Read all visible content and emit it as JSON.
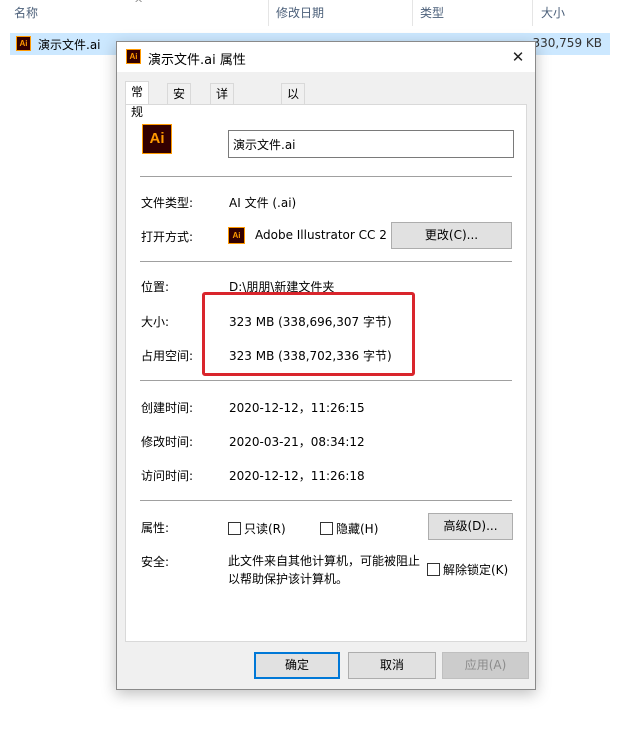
{
  "explorer": {
    "columns": [
      "名称",
      "修改日期",
      "类型",
      "大小"
    ],
    "file": {
      "icon": "ai-file-icon",
      "icon_text": "Ai",
      "name": "演示文件.ai",
      "size": "330,759 KB"
    }
  },
  "dialog": {
    "title": "演示文件.ai 属性",
    "title_icon_text": "Ai",
    "tabs": [
      "常规",
      "安全",
      "详细信息",
      "以前的版本"
    ],
    "big_icon_text": "Ai",
    "filename": "演示文件.ai",
    "file_type_label": "文件类型:",
    "file_type_value": "AI 文件 (.ai)",
    "open_with_label": "打开方式:",
    "open_with_icon_text": "Ai",
    "open_with_value": "Adobe Illustrator CC 2",
    "change_button": "更改(C)...",
    "location_label": "位置:",
    "location_value": "D:\\朋朋\\新建文件夹",
    "size_label": "大小:",
    "size_value": "323 MB (338,696,307 字节)",
    "disk_size_label": "占用空间:",
    "disk_size_value": "323 MB (338,702,336 字节)",
    "created_label": "创建时间:",
    "created_value": "2020-12-12，11:26:15",
    "modified_label": "修改时间:",
    "modified_value": "2020-03-21，08:34:12",
    "accessed_label": "访问时间:",
    "accessed_value": "2020-12-12，11:26:18",
    "attributes_label": "属性:",
    "readonly_label": "只读(R)",
    "hidden_label": "隐藏(H)",
    "advanced_button": "高级(D)...",
    "security_label": "安全:",
    "security_text": "此文件来自其他计算机，可能被阻止以帮助保护该计算机。",
    "unblock_label": "解除锁定(K)",
    "ok_button": "确定",
    "cancel_button": "取消",
    "apply_button": "应用(A)"
  },
  "colors": {
    "highlight_box": "#d9252c",
    "ai_icon_bg": "#330000",
    "ai_icon_fg": "#ff9a00",
    "selected_row": "#cce8ff"
  }
}
